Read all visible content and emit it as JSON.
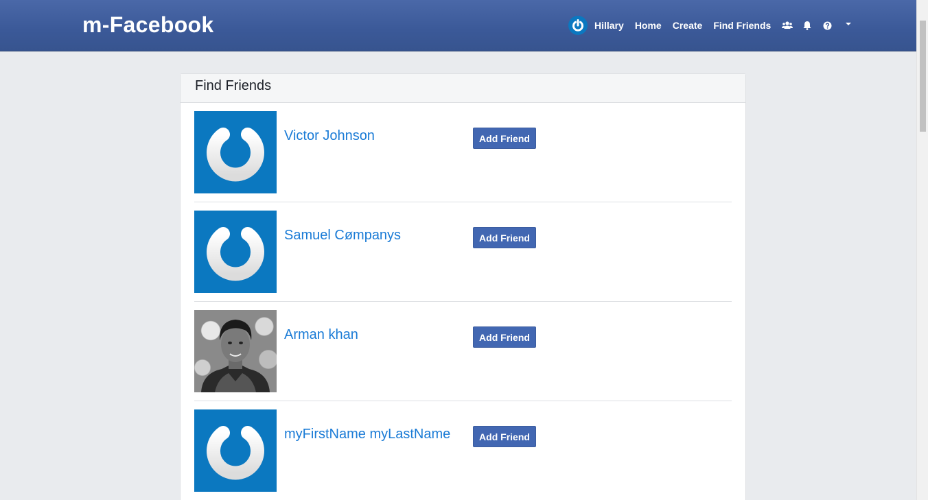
{
  "navbar": {
    "brand": "m-Facebook",
    "user_name": "Hillary",
    "links": [
      "Home",
      "Create",
      "Find Friends"
    ],
    "icons": [
      "users-icon",
      "bell-icon",
      "help-icon",
      "caret-down-icon"
    ]
  },
  "card": {
    "title": "Find Friends"
  },
  "friends": [
    {
      "name": "Victor Johnson",
      "photo": "default-power-avatar",
      "button": "Add Friend"
    },
    {
      "name": "Samuel Cømpanys",
      "photo": "default-power-avatar",
      "button": "Add Friend"
    },
    {
      "name": "Arman khan",
      "photo": "profile-photo",
      "button": "Add Friend"
    },
    {
      "name": "myFirstName myLastName",
      "photo": "default-power-avatar",
      "button": "Add Friend"
    }
  ],
  "colors": {
    "navbar": "#3b5998",
    "button": "#4267b2",
    "link": "#1a7bd6",
    "avatar_bg": "#0b78c0",
    "page_bg": "#e9ebee"
  }
}
